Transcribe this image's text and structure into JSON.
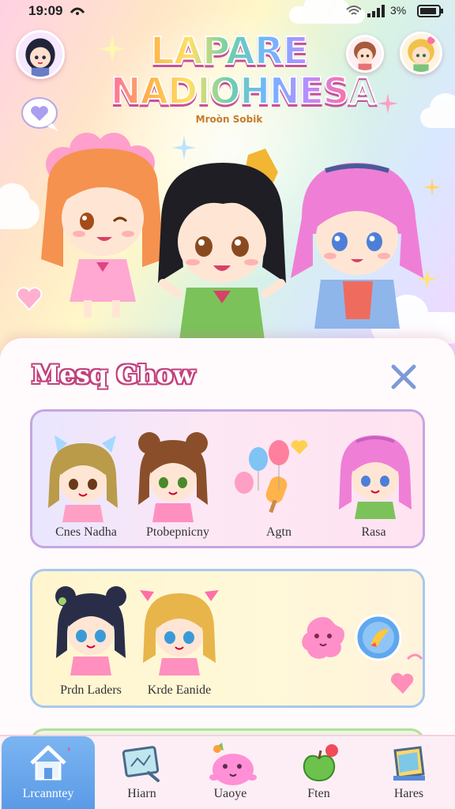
{
  "status_bar": {
    "time": "19:09",
    "battery_percent": "3%"
  },
  "header": {
    "logo_line1": "LAPARE",
    "logo_line2": "NADIOHNESA",
    "logo_subtitle": "Mroòn Sobik"
  },
  "panel": {
    "title": "Mesq Ghow"
  },
  "roster": {
    "row1": [
      {
        "name": "Cnes Nadha",
        "icon": "character-bow-hair"
      },
      {
        "name": "Ptobepnicny",
        "icon": "character-bun-hair"
      },
      {
        "name": "Agtn",
        "icon": "balloons-and-popsicle"
      },
      {
        "name": "Rasa",
        "icon": "character-pink-hair"
      }
    ],
    "row2": [
      {
        "name": "Prdn Laders",
        "icon": "character-navy-bun"
      },
      {
        "name": "Krde Eanide",
        "icon": "character-blonde-bow"
      },
      {
        "name": "",
        "icon": "pink-blob-pet"
      },
      {
        "name": "",
        "icon": "brush-orb"
      }
    ]
  },
  "nav": {
    "items": [
      {
        "label": "Lrcanntey",
        "icon": "home-icon",
        "active": true
      },
      {
        "label": "Hiarn",
        "icon": "canvas-icon",
        "active": false
      },
      {
        "label": "Uaoye",
        "icon": "pet-icon",
        "active": false
      },
      {
        "label": "Ften",
        "icon": "apple-icon",
        "active": false
      },
      {
        "label": "Hares",
        "icon": "book-icon",
        "active": false
      }
    ]
  },
  "colors": {
    "accent_pink": "#c2417d",
    "nav_active": "#5a9ae6",
    "panel_bg": "#fffafc"
  }
}
